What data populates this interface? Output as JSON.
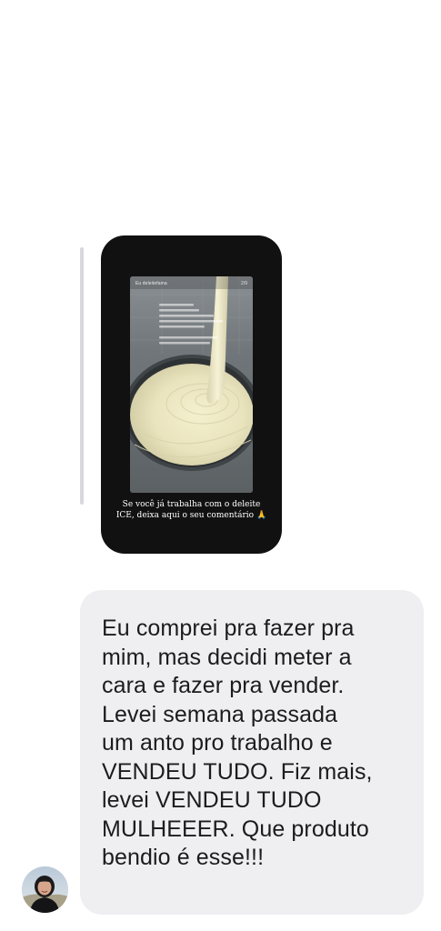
{
  "story_reply": {
    "username": "Eu deleitefama",
    "page_indicator": "2/9",
    "caption_line1": "Se você já trabalha com o deleite",
    "caption_line2": "ICE, deixa aqui o seu comentário",
    "caption_emoji": "🙏"
  },
  "message": {
    "text": "Eu comprei pra fazer pra\nmim, mas decidi meter a\ncara e fazer pra vender.\nLevei semana passada\num anto pro trabalho e\nVENDEU TUDO. Fiz mais,\nlevei VENDEU TUDO\nMULHEEER. Que produto\nbendio é esse!!!"
  },
  "colors": {
    "bubble_bg": "#efeff2",
    "card_bg": "#111111",
    "text": "#1c1c1e",
    "reply_bar": "#d9d9dc"
  }
}
